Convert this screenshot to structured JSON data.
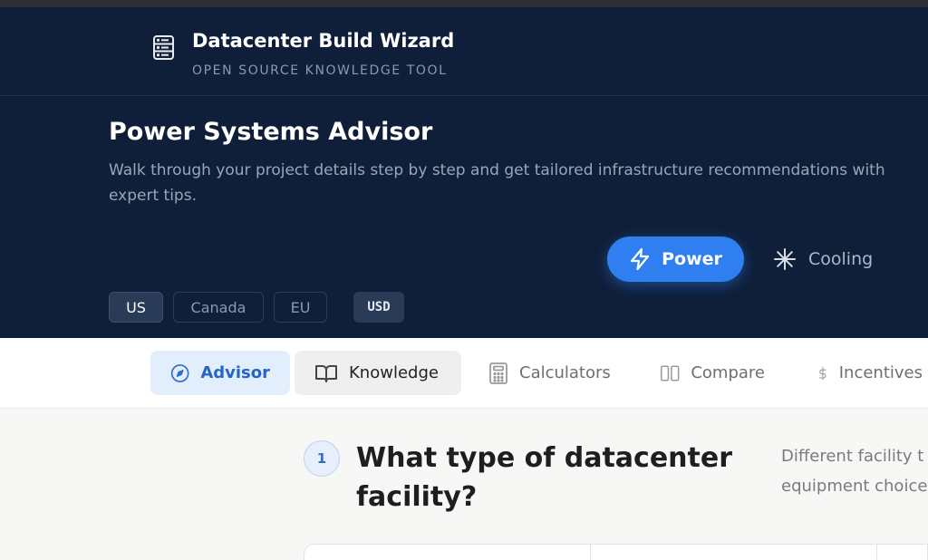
{
  "brand": {
    "title": "Datacenter Build Wizard",
    "subtitle": "OPEN SOURCE KNOWLEDGE TOOL",
    "icon": "server-rack-icon"
  },
  "hero": {
    "title": "Power Systems Advisor",
    "description": "Walk through your project details step by step and get tailored infrastructure recommendations with expert tips."
  },
  "modes": [
    {
      "label": "Power",
      "icon": "lightning-icon",
      "active": true
    },
    {
      "label": "Cooling",
      "icon": "snowflake-icon",
      "active": false
    }
  ],
  "regions": [
    {
      "label": "US",
      "active": true
    },
    {
      "label": "Canada",
      "active": false
    },
    {
      "label": "EU",
      "active": false
    }
  ],
  "currency": "USD",
  "tabs": [
    {
      "label": "Advisor",
      "icon": "compass-icon",
      "state": "active"
    },
    {
      "label": "Knowledge",
      "icon": "book-icon",
      "state": "hover"
    },
    {
      "label": "Calculators",
      "icon": "calculator-icon",
      "state": "default"
    },
    {
      "label": "Compare",
      "icon": "columns-icon",
      "state": "default"
    },
    {
      "label": "Incentives",
      "icon": "dollar-icon",
      "state": "default"
    }
  ],
  "step": {
    "number": "1",
    "question": "What type of datacenter facility?",
    "help_line1": "Different facility t",
    "help_line2": "equipment choice"
  },
  "colors": {
    "hero_bg": "#0f1f3a",
    "accent": "#2f7ff0",
    "active_tab_bg": "#e3eefc",
    "active_tab_text": "#2564c8"
  }
}
